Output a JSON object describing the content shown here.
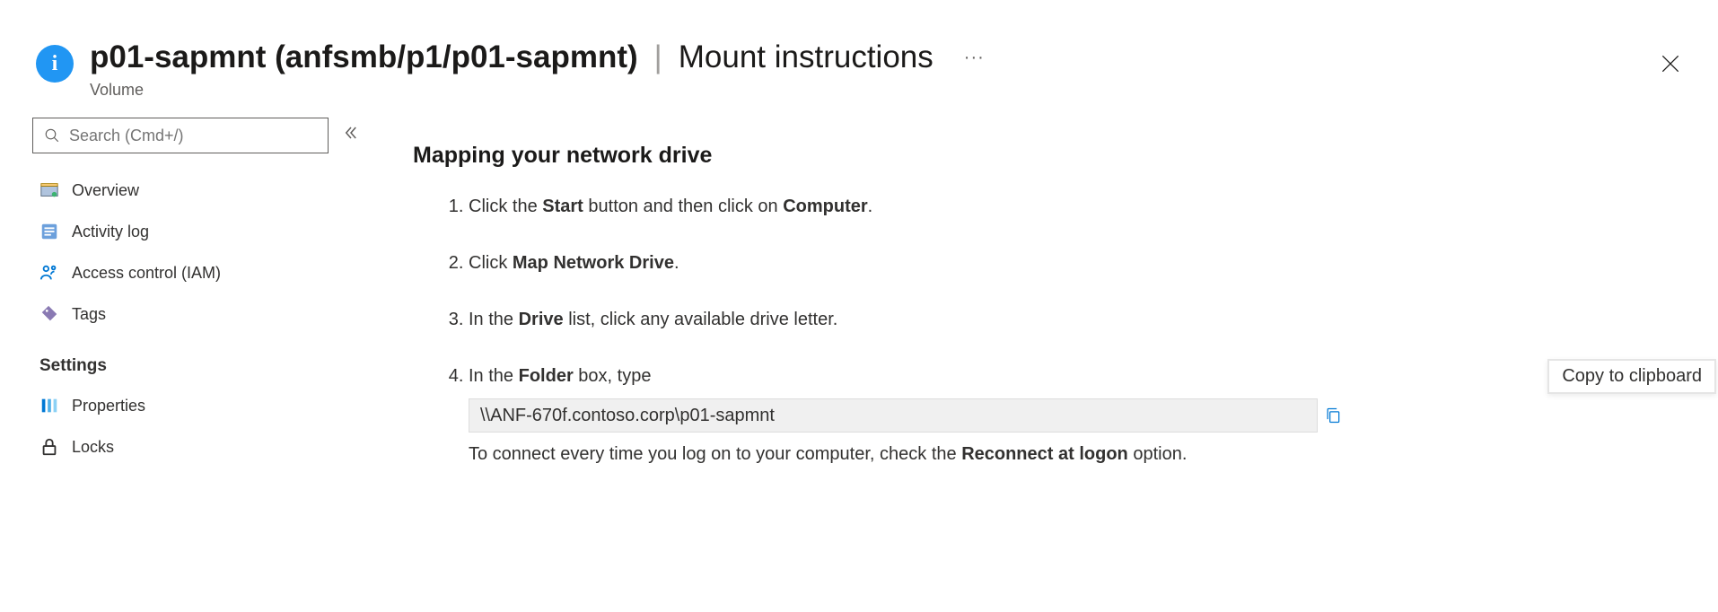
{
  "header": {
    "title_bold": "p01-sapmnt (anfsmb/p1/p01-sapmnt)",
    "title_light": "Mount instructions",
    "subtitle": "Volume",
    "more_label": "···"
  },
  "sidebar": {
    "search_placeholder": "Search (Cmd+/)",
    "items": [
      {
        "id": "overview",
        "label": "Overview"
      },
      {
        "id": "activity-log",
        "label": "Activity log"
      },
      {
        "id": "iam",
        "label": "Access control (IAM)"
      },
      {
        "id": "tags",
        "label": "Tags"
      }
    ],
    "section": "Settings",
    "settings_items": [
      {
        "id": "properties",
        "label": "Properties"
      },
      {
        "id": "locks",
        "label": "Locks"
      }
    ]
  },
  "content": {
    "heading": "Mapping your network drive",
    "step1": {
      "pre": "Click the ",
      "b1": "Start",
      "mid": " button and then click on ",
      "b2": "Computer",
      "post": "."
    },
    "step2": {
      "pre": "Click ",
      "b1": "Map Network Drive",
      "post": "."
    },
    "step3": {
      "pre": "In the ",
      "b1": "Drive",
      "post": " list, click any available drive letter."
    },
    "step4": {
      "pre": "In the ",
      "b1": "Folder",
      "mid": " box, type",
      "path": "\\\\ANF-670f.contoso.corp\\p01-sapmnt",
      "after_pre": "To connect every time you log on to your computer, check the ",
      "after_b": "Reconnect at logon",
      "after_post": " option."
    },
    "tooltip": "Copy to clipboard"
  }
}
